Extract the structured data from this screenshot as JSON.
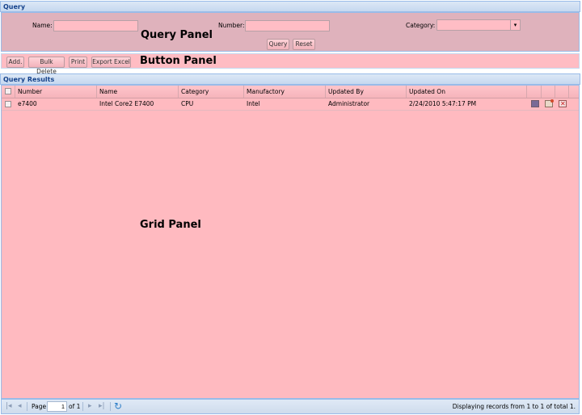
{
  "query_panel": {
    "title": "Query",
    "name_label": "Name:",
    "number_label": "Number:",
    "category_label": "Category:",
    "name_value": "",
    "number_value": "",
    "category_value": "",
    "query_button": "Query",
    "reset_button": "Reset",
    "annotation": "Query Panel"
  },
  "button_panel": {
    "add": "Add.",
    "bulk_delete": "Bulk Delete",
    "print": "Print",
    "export_excel": "Export Excel",
    "annotation": "Button Panel"
  },
  "results": {
    "title": "Query Results",
    "columns": [
      "Number",
      "Name",
      "Category",
      "Manufactory",
      "Updated By",
      "Updated On"
    ],
    "rows": [
      {
        "number": "e7400",
        "name": "Intel Core2 E7400",
        "category": "CPU",
        "manufactory": "Intel",
        "updated_by": "Administrator",
        "updated_on": "2/24/2010 5:47:17 PM",
        "actions": [
          "view-icon",
          "edit-icon",
          "delete-icon"
        ]
      }
    ],
    "annotation": "Grid Panel"
  },
  "pager": {
    "page_label": "Page",
    "page_value": "1",
    "of_label": "of 1",
    "status": "Displaying records from 1 to 1 of total 1.",
    "icons": [
      "first-page-icon",
      "prev-page-icon",
      "next-page-icon",
      "last-page-icon",
      "refresh-icon"
    ]
  },
  "colors": {
    "header_text": "#15428b",
    "panel_pink": "#ffbac0",
    "query_pink": "#dfb2bc",
    "border_blue": "#99bbe8"
  }
}
